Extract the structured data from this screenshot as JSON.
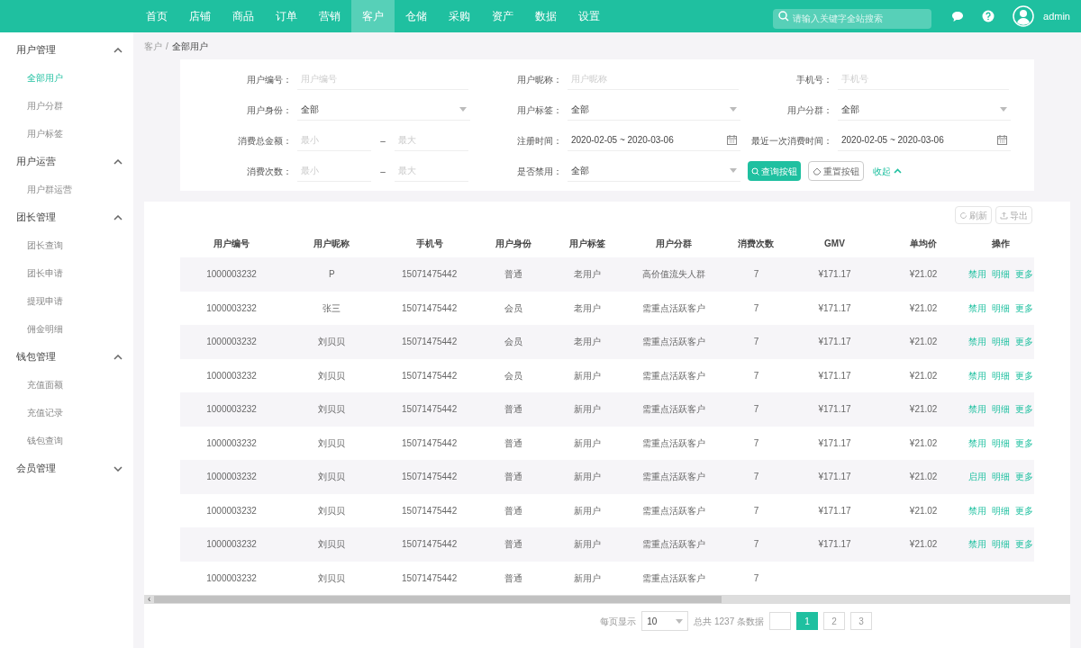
{
  "nav": [
    {
      "label": "首页",
      "selected": false
    },
    {
      "label": "店铺",
      "selected": false
    },
    {
      "label": "商品",
      "selected": false
    },
    {
      "label": "订单",
      "selected": false
    },
    {
      "label": "营销",
      "selected": false
    },
    {
      "label": "客户",
      "selected": true
    },
    {
      "label": "仓储",
      "selected": false
    },
    {
      "label": "采购",
      "selected": false
    },
    {
      "label": "资产",
      "selected": false
    },
    {
      "label": "数据",
      "selected": false
    },
    {
      "label": "设置",
      "selected": false
    }
  ],
  "search": {
    "placeholder": "请输入关键字全站搜索"
  },
  "user": {
    "name": "admin"
  },
  "sidebar": [
    {
      "label": "用户管理",
      "expanded": true,
      "children": [
        {
          "label": "全部用户",
          "selected": true
        },
        {
          "label": "用户分群",
          "selected": false
        },
        {
          "label": "用户标签",
          "selected": false
        }
      ]
    },
    {
      "label": "用户运营",
      "expanded": true,
      "children": [
        {
          "label": "用户群运营",
          "selected": false
        }
      ]
    },
    {
      "label": "团长管理",
      "expanded": true,
      "children": [
        {
          "label": "团长查询",
          "selected": false
        },
        {
          "label": "团长申请",
          "selected": false
        },
        {
          "label": "提现申请",
          "selected": false
        },
        {
          "label": "佣金明细",
          "selected": false
        }
      ]
    },
    {
      "label": "钱包管理",
      "expanded": true,
      "children": [
        {
          "label": "充值面额",
          "selected": false
        },
        {
          "label": "充值记录",
          "selected": false
        },
        {
          "label": "钱包查询",
          "selected": false
        }
      ]
    },
    {
      "label": "会员管理",
      "expanded": false
    }
  ],
  "breadcrumb": {
    "items": [
      "客户",
      "全部用户"
    ],
    "separator": "/"
  },
  "scroll_left": "‹",
  "filters": [
    [
      {
        "kind": "text",
        "label": "用户编号：",
        "placeholder": "用户编号"
      },
      {
        "kind": "text",
        "label": "用户昵称：",
        "placeholder": "用户昵称"
      },
      {
        "kind": "text",
        "label": "手机号：",
        "placeholder": "手机号"
      }
    ],
    [
      {
        "kind": "select",
        "label": "用户身份：",
        "value": "全部"
      },
      {
        "kind": "select",
        "label": "用户标签：",
        "value": "全部"
      },
      {
        "kind": "select",
        "label": "用户分群：",
        "value": "全部"
      }
    ],
    [
      {
        "kind": "range",
        "label": "消费总金额：",
        "min_placeholder": "最小",
        "sep": "–",
        "max_placeholder": "最大"
      },
      {
        "kind": "date",
        "label": "注册时间：",
        "value": "2020-02-05 ~ 2020-03-06"
      },
      {
        "kind": "date",
        "label": "最近一次消费时间：",
        "value": "2020-02-05 ~ 2020-03-06"
      }
    ],
    [
      {
        "kind": "range",
        "label": "消费次数：",
        "min_placeholder": "最小",
        "sep": "–",
        "max_placeholder": "最大"
      },
      {
        "kind": "select",
        "label": "是否禁用：",
        "value": "全部"
      },
      {
        "kind": "buttons"
      }
    ]
  ],
  "filter_buttons": {
    "query": "查询按钮",
    "reset": "重置按钮",
    "collapse": "收起"
  },
  "table_tools": [
    "刷新",
    "导出"
  ],
  "table": {
    "columns": [
      "用户编号",
      "用户昵称",
      "手机号",
      "用户身份",
      "用户标签",
      "用户分群",
      "消费次数",
      "GMV",
      "单均价",
      "操作"
    ],
    "rows": [
      {
        "cells": [
          "1000003232",
          "P",
          "15071475442",
          "普通",
          "老用户",
          "高价值流失人群",
          "7",
          "¥171.17",
          "¥21.02"
        ],
        "actions": [
          "禁用",
          "明细",
          "更多"
        ]
      },
      {
        "cells": [
          "1000003232",
          "张三",
          "15071475442",
          "会员",
          "老用户",
          "需重点活跃客户",
          "7",
          "¥171.17",
          "¥21.02"
        ],
        "actions": [
          "禁用",
          "明细",
          "更多"
        ]
      },
      {
        "cells": [
          "1000003232",
          "刘贝贝",
          "15071475442",
          "会员",
          "老用户",
          "需重点活跃客户",
          "7",
          "¥171.17",
          "¥21.02"
        ],
        "actions": [
          "禁用",
          "明细",
          "更多"
        ]
      },
      {
        "cells": [
          "1000003232",
          "刘贝贝",
          "15071475442",
          "会员",
          "新用户",
          "需重点活跃客户",
          "7",
          "¥171.17",
          "¥21.02"
        ],
        "actions": [
          "禁用",
          "明细",
          "更多"
        ]
      },
      {
        "cells": [
          "1000003232",
          "刘贝贝",
          "15071475442",
          "普通",
          "新用户",
          "需重点活跃客户",
          "7",
          "¥171.17",
          "¥21.02"
        ],
        "actions": [
          "禁用",
          "明细",
          "更多"
        ]
      },
      {
        "cells": [
          "1000003232",
          "刘贝贝",
          "15071475442",
          "普通",
          "新用户",
          "需重点活跃客户",
          "7",
          "¥171.17",
          "¥21.02"
        ],
        "actions": [
          "禁用",
          "明细",
          "更多"
        ]
      },
      {
        "cells": [
          "1000003232",
          "刘贝贝",
          "15071475442",
          "普通",
          "新用户",
          "需重点活跃客户",
          "7",
          "¥171.17",
          "¥21.02"
        ],
        "actions": [
          "启用",
          "明细",
          "更多"
        ]
      },
      {
        "cells": [
          "1000003232",
          "刘贝贝",
          "15071475442",
          "普通",
          "新用户",
          "需重点活跃客户",
          "7",
          "¥171.17",
          "¥21.02"
        ],
        "actions": [
          "禁用",
          "明细",
          "更多"
        ]
      },
      {
        "cells": [
          "1000003232",
          "刘贝贝",
          "15071475442",
          "普通",
          "新用户",
          "需重点活跃客户",
          "7",
          "¥171.17",
          "¥21.02"
        ],
        "actions": [
          "禁用",
          "明细",
          "更多"
        ]
      },
      {
        "cells": [
          "1000003232",
          "刘贝贝",
          "15071475442",
          "普通",
          "新用户",
          "需重点活跃客户",
          "7"
        ],
        "actions": []
      }
    ]
  },
  "pagination": {
    "page_size_label": "每页显示",
    "page_size": "10",
    "total": "总共 1237 条数据",
    "pages": [
      {
        "label": "1",
        "selected": true
      },
      {
        "label": "2",
        "selected": false
      },
      {
        "label": "3",
        "selected": false
      }
    ]
  }
}
